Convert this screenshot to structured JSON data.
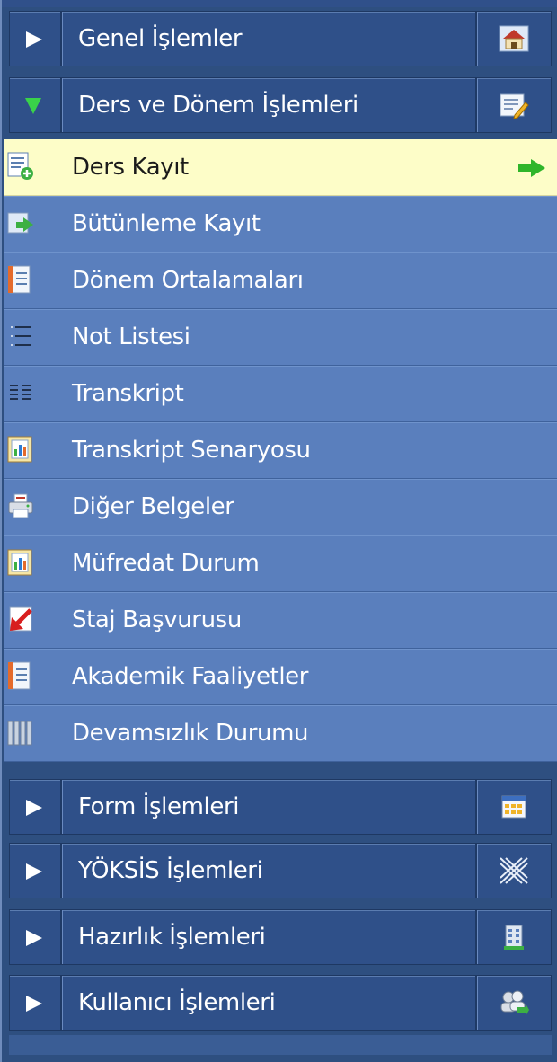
{
  "sections_top": [
    {
      "key": "genel",
      "label": "Genel İşlemler",
      "expanded": false,
      "icon": "home-icon"
    },
    {
      "key": "ders",
      "label": "Ders ve Dönem İşlemleri",
      "expanded": true,
      "icon": "edit-form-icon"
    }
  ],
  "items": [
    {
      "label": "Ders Kayıt",
      "icon": "form-add-icon",
      "active": true
    },
    {
      "label": "Bütünleme Kayıt",
      "icon": "form-arrow-icon"
    },
    {
      "label": "Dönem Ortalamaları",
      "icon": "notebook-icon"
    },
    {
      "label": "Not Listesi",
      "icon": "list-icon"
    },
    {
      "label": "Transkript",
      "icon": "columns-icon"
    },
    {
      "label": "Transkript Senaryosu",
      "icon": "chart-doc-icon"
    },
    {
      "label": "Diğer Belgeler",
      "icon": "printer-icon"
    },
    {
      "label": "Müfredat Durum",
      "icon": "chart-doc-icon"
    },
    {
      "label": "Staj Başvurusu",
      "icon": "red-arrow-icon"
    },
    {
      "label": "Akademik Faaliyetler",
      "icon": "notebook-icon"
    },
    {
      "label": "Devamsızlık Durumu",
      "icon": "pillars-icon"
    }
  ],
  "sections_bottom": [
    {
      "key": "form",
      "label": "Form İşlemleri",
      "expanded": false,
      "icon": "calendar-grid-icon"
    },
    {
      "key": "yoksis",
      "label": "YÖKSİS İşlemleri",
      "expanded": false,
      "icon": "yoksis-logo-icon"
    },
    {
      "key": "hazirlik",
      "label": "Hazırlık İşlemleri",
      "expanded": false,
      "icon": "building-icon"
    },
    {
      "key": "kullanici",
      "label": "Kullanıcı İşlemleri",
      "expanded": false,
      "icon": "users-icon"
    }
  ],
  "colors": {
    "header_bg": "#2f5089",
    "item_bg": "#5a7fbd",
    "active_bg": "#fdfdc8",
    "expanded_arrow": "#39d24a",
    "go_arrow": "#2fb52a"
  }
}
